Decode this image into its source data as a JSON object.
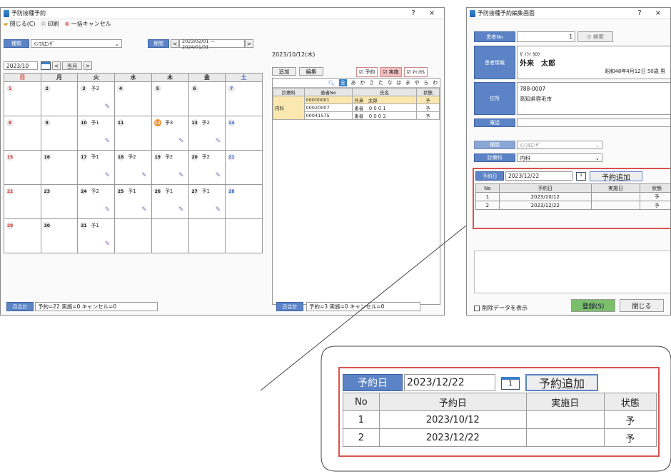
{
  "main_window": {
    "title": "予防接種予約",
    "close_btn": "閉じる(C)",
    "print_btn": "印刷",
    "cancel_all_btn": "一括キャンセル",
    "help": "?",
    "close": "×",
    "type_label": "種類",
    "type_value": "ｲﾝﾌﾙｴﾝｻﾞ",
    "period_label": "期間",
    "period_value": "2023/02/01 ～ 2024/01/31",
    "month_value": "2023/10",
    "current_month_btn": "当月",
    "weekdays": [
      "日",
      "月",
      "火",
      "水",
      "木",
      "金",
      "土"
    ],
    "weeks": [
      [
        {
          "d": "1",
          "y": ""
        },
        {
          "d": "2",
          "y": ""
        },
        {
          "d": "3",
          "y": "予3"
        },
        {
          "d": "4",
          "y": ""
        },
        {
          "d": "5",
          "y": ""
        },
        {
          "d": "6",
          "y": ""
        },
        {
          "d": "7",
          "y": ""
        }
      ],
      [
        {
          "d": "8",
          "y": ""
        },
        {
          "d": "9",
          "y": ""
        },
        {
          "d": "10",
          "y": "予1"
        },
        {
          "d": "11",
          "y": ""
        },
        {
          "d": "12",
          "y": "予3"
        },
        {
          "d": "13",
          "y": "予2"
        },
        {
          "d": "14",
          "y": ""
        }
      ],
      [
        {
          "d": "15",
          "y": ""
        },
        {
          "d": "16",
          "y": ""
        },
        {
          "d": "17",
          "y": "予1"
        },
        {
          "d": "18",
          "y": "予2"
        },
        {
          "d": "19",
          "y": "予2"
        },
        {
          "d": "20",
          "y": "予2"
        },
        {
          "d": "21",
          "y": ""
        }
      ],
      [
        {
          "d": "22",
          "y": ""
        },
        {
          "d": "23",
          "y": ""
        },
        {
          "d": "24",
          "y": "予2"
        },
        {
          "d": "25",
          "y": "予1"
        },
        {
          "d": "26",
          "y": "予1"
        },
        {
          "d": "27",
          "y": "予1"
        },
        {
          "d": "28",
          "y": ""
        }
      ],
      [
        {
          "d": "29",
          "y": ""
        },
        {
          "d": "30",
          "y": ""
        },
        {
          "d": "31",
          "y": "予1"
        },
        {
          "d": "",
          "y": ""
        },
        {
          "d": "",
          "y": ""
        },
        {
          "d": "",
          "y": ""
        },
        {
          "d": "",
          "y": ""
        }
      ]
    ],
    "month_total_label": "月合計",
    "month_total": "予約=22 実施=0 キャンセル=0",
    "selected_date": "2023/10/12(木)",
    "add_btn": "追加",
    "edit_btn": "編集",
    "filters": [
      "予約",
      "実施",
      "ｷｬﾝｾﾙ"
    ],
    "kana": [
      "全",
      "あ",
      "か",
      "さ",
      "た",
      "な",
      "は",
      "ま",
      "や",
      "ら",
      "わ"
    ],
    "right_cols": [
      "診療科",
      "患者No",
      "氏名",
      "状態"
    ],
    "dept": "内科",
    "right_rows": [
      [
        "00000001",
        "外来　太郎",
        "予"
      ],
      [
        "00020007",
        "患者　０００１",
        "予"
      ],
      [
        "00041575",
        "患者　０００２",
        "予"
      ]
    ],
    "day_total_label": "日合計",
    "day_total": "予約=3 実施=0 キャンセル=0"
  },
  "edit_window": {
    "title": "予防接種予約編集画面",
    "help": "?",
    "close": "×",
    "patient_no_label": "患者No",
    "patient_no": "1",
    "search_btn": "検索",
    "patient_info_label": "患者情報",
    "kana_name": "ｶﾞｲﾗｲ ﾀﾛｳ",
    "name": "外来　太郎",
    "birth": "昭和48年4月12日 50歳 男",
    "address_label": "住所",
    "zip": "788-0007",
    "address": "高知県宿毛市",
    "phone_label": "電話",
    "type_label": "種類",
    "type_value": "ｲﾝﾌﾙｴﾝｻﾞ",
    "dept_label": "診療科",
    "dept_value": "内科",
    "res_date_label": "予約日",
    "res_date": "2023/12/22",
    "add_res_btn": "予約追加",
    "cols": [
      "No",
      "予約日",
      "実施日",
      "状態"
    ],
    "rows": [
      [
        "1",
        "2023/10/12",
        "",
        "予"
      ],
      [
        "2",
        "2023/12/22",
        "",
        "予"
      ]
    ],
    "show_deleted": "削除データを表示",
    "register_btn": "登録(S)",
    "close_btn": "閉じる"
  },
  "colors": {
    "accent": "#5b83c6",
    "highlight_border": "#d9534f",
    "register_green": "#7cbf6a"
  }
}
